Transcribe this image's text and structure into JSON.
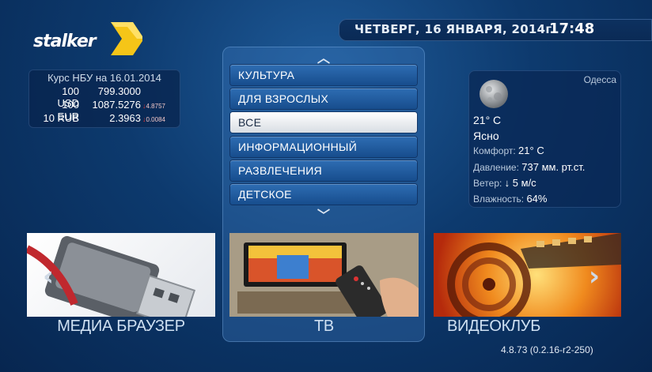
{
  "header": {
    "date": "ЧЕТВЕРГ, 16 ЯНВАРЯ, 2014г.",
    "time": "17:48"
  },
  "logo": {
    "text": "stalker"
  },
  "currency": {
    "title": "Курс НБУ на 16.01.2014",
    "rows": [
      {
        "name": "100 USD",
        "value": "799.3000",
        "change": ""
      },
      {
        "name": "100 EUR",
        "value": "1087.5276",
        "change": "4.8757"
      },
      {
        "name": "10 RUB",
        "value": "2.3963",
        "change": "0.0084"
      }
    ]
  },
  "categories": {
    "items": [
      "КУЛЬТУРА",
      "ДЛЯ ВЗРОСЛЫХ",
      "ВСЕ",
      "ИНФОРМАЦИОННЫЙ",
      "РАЗВЛЕЧЕНИЯ",
      "ДЕТСКОЕ"
    ],
    "selected_index": 2
  },
  "weather": {
    "city": "Одесса",
    "icon": "moon-icon",
    "temp": "21° C",
    "condition": "Ясно",
    "comfort_label": "Комфорт:",
    "comfort_value": "21° C",
    "pressure_label": "Давление:",
    "pressure_value": "737 мм. рт.ст.",
    "wind_label": "Ветер:",
    "wind_value": "↓ 5 м/с",
    "humidity_label": "Влажность:",
    "humidity_value": "64%"
  },
  "tiles": [
    {
      "label": "МЕДИА БРАУЗЕР",
      "icon": "usb-drive-icon"
    },
    {
      "label": "ТВ",
      "icon": "tv-remote-icon"
    },
    {
      "label": "ВИДЕОКЛУБ",
      "icon": "film-reel-icon"
    }
  ],
  "version": "4.8.73 (0.2.16-r2-250)",
  "colors": {
    "selected_bg": "#ffffff",
    "item_bg": "#2e6db3",
    "accent_logo": "#f5c518",
    "down_arrow": "#e03030"
  }
}
